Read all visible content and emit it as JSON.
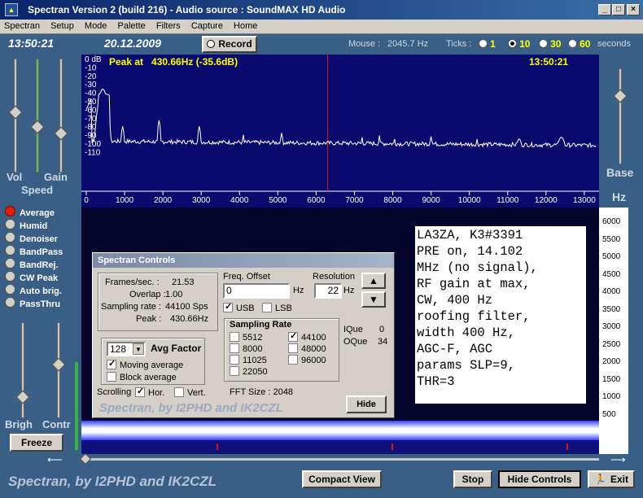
{
  "window": {
    "title": "Spectran Version 2 (build 216) - Audio source  :  SoundMAX HD Audio",
    "icon": "app-icon"
  },
  "menu": [
    "Spectran",
    "Setup",
    "Mode",
    "Palette",
    "Filters",
    "Capture",
    "Home"
  ],
  "info": {
    "time": "13:50:21",
    "date": "20.12.2009",
    "record_label": "Record",
    "mouse_label": "Mouse :",
    "mouse_value": "2045.7 Hz",
    "ticks_label": "Ticks :",
    "ticks": [
      {
        "value": "1",
        "selected": false
      },
      {
        "value": "10",
        "selected": true
      },
      {
        "value": "30",
        "selected": false
      },
      {
        "value": "60",
        "selected": false
      }
    ],
    "seconds_label": "seconds"
  },
  "left": {
    "vol": "Vol",
    "gain": "Gain",
    "speed": "Speed",
    "modes": [
      {
        "label": "Average",
        "on": true
      },
      {
        "label": "Humid",
        "on": false
      },
      {
        "label": "Denoiser",
        "on": false
      },
      {
        "label": "BandPass",
        "on": false
      },
      {
        "label": "BandRej.",
        "on": false
      },
      {
        "label": "CW Peak",
        "on": false
      },
      {
        "label": "Auto brig.",
        "on": false
      },
      {
        "label": "PassThru",
        "on": false
      }
    ],
    "brigh": "Brigh",
    "contr": "Contr",
    "freeze": "Freeze"
  },
  "spectrum": {
    "peak_text": "Peak at   430.66Hz (-35.6dB)",
    "time": "13:50:21",
    "db_labels": [
      "0 dB",
      "-10",
      "-20",
      "-30",
      "-40",
      "-50",
      "-60",
      "-70",
      "-80",
      "-90",
      "-100",
      "-110"
    ],
    "hz_labels": [
      "0",
      "1000",
      "2000",
      "3000",
      "4000",
      "5000",
      "6000",
      "7000",
      "8000",
      "9000",
      "10000",
      "11000",
      "12000",
      "13000"
    ],
    "base": "Base",
    "hz_unit": "Hz",
    "marker_hz": 6300
  },
  "waterfall": {
    "scale": [
      "6000",
      "5500",
      "5000",
      "4500",
      "4000",
      "3500",
      "3000",
      "2500",
      "2000",
      "1500",
      "1000",
      "500"
    ]
  },
  "controls": {
    "title": "Spectran Controls",
    "frames_label": "Frames/sec. :",
    "frames_value": "21.53",
    "overlap_label": "Overlap :",
    "overlap_value": "1.00",
    "sampling_label": "Sampling rate :",
    "sampling_value": "44100 Sps",
    "peak_label": "Peak :",
    "peak_value": "430.66Hz",
    "avg_value": "128",
    "avg_label": "Avg Factor",
    "moving_avg": "Moving average",
    "block_avg": "Block average",
    "freq_offset_label": "Freq. Offset",
    "freq_offset_value": "0",
    "hz": "Hz",
    "resolution_label": "Resolution",
    "resolution_value": "22",
    "usb": "USB",
    "lsb": "LSB",
    "sampling_rate_title": "Sampling Rate",
    "rates_left": [
      {
        "label": "5512",
        "on": false
      },
      {
        "label": "8000",
        "on": false
      },
      {
        "label": "11025",
        "on": false
      },
      {
        "label": "22050",
        "on": false
      }
    ],
    "rates_right": [
      {
        "label": "44100",
        "on": true
      },
      {
        "label": "48000",
        "on": false
      },
      {
        "label": "96000",
        "on": false
      }
    ],
    "ique_label": "IQue",
    "ique_value": "0",
    "oque_label": "OQue",
    "oque_value": "34",
    "scrolling_label": "Scrolling",
    "hor": "Hor.",
    "vert": "Vert.",
    "fft_label": "FFT Size : 2048",
    "watermark": "Spectran, by I2PHD and IK2CZL",
    "hide": "Hide"
  },
  "note": "LA3ZA, K3#3391\nPRE on, 14.102\nMHz (no signal),\nRF gain at max,\nCW, 400 Hz\nroofing filter,\nwidth 400 Hz,\nAGC-F, AGC\nparams SLP=9,\nTHR=3",
  "bottom": {
    "brand": "Spectran, by I2PHD and IK2CZL",
    "compact": "Compact View",
    "stop": "Stop",
    "hide_controls": "Hide Controls",
    "exit": "Exit"
  },
  "colors": {
    "background": "#3a5f87",
    "spectrum_bg": "#0a0a6e",
    "trace": "#ffffff",
    "marker": "#d01818",
    "peak_text": "#ffff00"
  }
}
